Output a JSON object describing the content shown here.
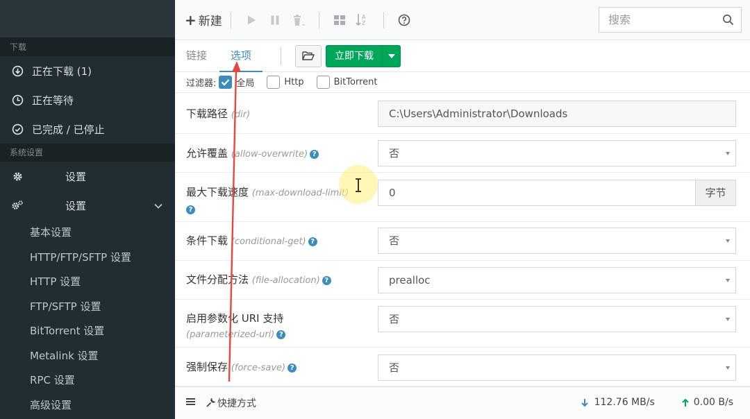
{
  "sidebar": {
    "section_download": "下载",
    "items_download": [
      {
        "label": "正在下载 (1)",
        "icon": "download-circle-icon"
      },
      {
        "label": "正在等待",
        "icon": "clock-icon"
      },
      {
        "label": "已完成 / 已停止",
        "icon": "check-circle-icon"
      }
    ],
    "section_settings": "系统设置",
    "settings_item": {
      "label": "设置",
      "icon": "gear-icon"
    },
    "settings_group": {
      "label": "设置",
      "icon": "gears-icon"
    },
    "sub_items": [
      "基本设置",
      "HTTP/FTP/SFTP 设置",
      "HTTP 设置",
      "FTP/SFTP 设置",
      "BitTorrent 设置",
      "Metalink 设置",
      "RPC 设置",
      "高级设置"
    ]
  },
  "toolbar": {
    "new_label": "新建",
    "search_placeholder": "搜索"
  },
  "tabs": {
    "links": "链接",
    "options": "选项",
    "download_now": "立即下载"
  },
  "filter": {
    "label": "过滤器:",
    "options": [
      "全局",
      "Http",
      "BitTorrent"
    ]
  },
  "options": [
    {
      "label": "下载路径",
      "key": "(dir)",
      "value": "C:\\Users\\Administrator\\Downloads"
    },
    {
      "label": "允许覆盖",
      "key": "(allow-overwrite)",
      "value": "否"
    },
    {
      "label": "最大下载速度",
      "key": "(max-download-limit)",
      "value": "0",
      "unit": "字节"
    },
    {
      "label": "条件下载",
      "key": "(conditional-get)",
      "value": "否"
    },
    {
      "label": "文件分配方法",
      "key": "(file-allocation)",
      "value": "prealloc"
    },
    {
      "label": "启用参数化 URI 支持",
      "key": "(parameterized-uri)",
      "value": "否"
    },
    {
      "label": "强制保存",
      "key": "(force-save)",
      "value": "否"
    }
  ],
  "footer": {
    "shortcut_label": "快捷方式",
    "download_speed": "112.76 MB/s",
    "upload_speed": "0.00 B/s"
  },
  "colors": {
    "accent": "#3c8dbc",
    "success": "#00a65a",
    "sidebar_bg": "#222d32",
    "annotation_arrow": "#e8453c"
  }
}
